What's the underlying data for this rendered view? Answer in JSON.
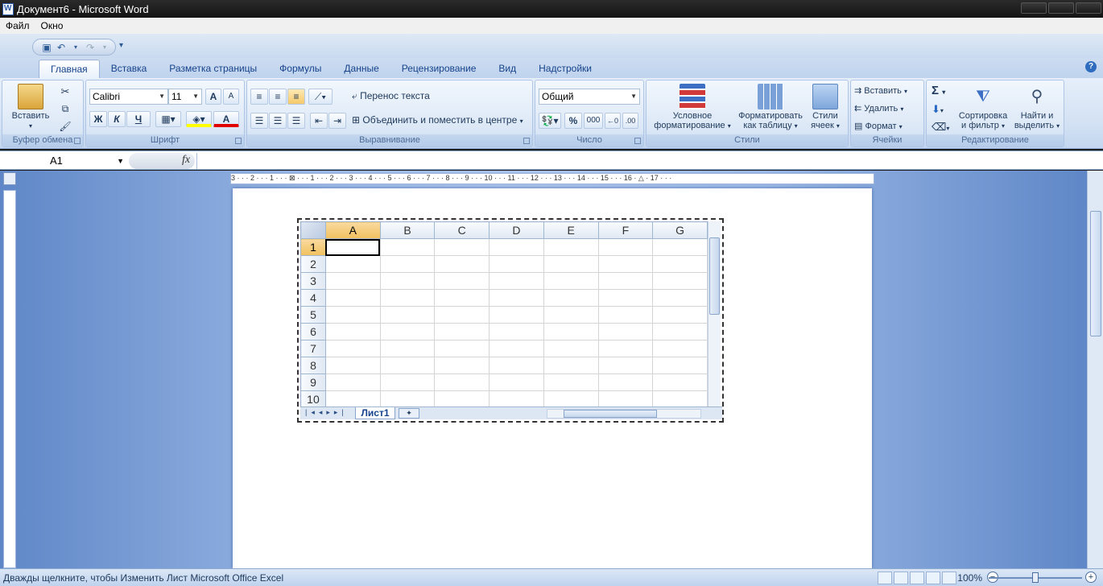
{
  "window": {
    "title": "Документ6 - Microsoft Word"
  },
  "menu": [
    "Файл",
    "Окно"
  ],
  "ribbon": {
    "tabs": [
      "Главная",
      "Вставка",
      "Разметка страницы",
      "Формулы",
      "Данные",
      "Рецензирование",
      "Вид",
      "Надстройки"
    ],
    "clipboard": {
      "paste": "Вставить",
      "label": "Буфер обмена"
    },
    "font": {
      "name": "Calibri",
      "size": "11",
      "label": "Шрифт",
      "bold": "Ж",
      "italic": "К",
      "underline": "Ч",
      "grow": "A",
      "shrink": "A",
      "font_color": "A"
    },
    "alignment": {
      "wrap": "Перенос текста",
      "merge": "Объединить и поместить в центре",
      "label": "Выравнивание"
    },
    "number": {
      "format": "Общий",
      "percent": "%",
      "thousands": "000",
      "label": "Число"
    },
    "styles": {
      "conditional_1": "Условное",
      "conditional_2": "форматирование",
      "table_1": "Форматировать",
      "table_2": "как таблицу",
      "cell_1": "Стили",
      "cell_2": "ячеек",
      "label": "Стили"
    },
    "cells": {
      "insert": "Вставить",
      "delete": "Удалить",
      "format": "Формат",
      "label": "Ячейки"
    },
    "editing": {
      "sum": "Σ",
      "sort_1": "Сортировка",
      "sort_2": "и фильтр",
      "find_1": "Найти и",
      "find_2": "выделить",
      "label": "Редактирование"
    }
  },
  "formula_bar": {
    "name_box": "A1",
    "fx": "fx",
    "value": ""
  },
  "sheet": {
    "columns": [
      "A",
      "B",
      "C",
      "D",
      "E",
      "F",
      "G"
    ],
    "rows": [
      "1",
      "2",
      "3",
      "4",
      "5",
      "6",
      "7",
      "8",
      "9",
      "10"
    ],
    "active_cell": "A1",
    "tab": "Лист1"
  },
  "ruler": {
    "labels": "3 · · · 2 · · · 1 · · · ⊠ · · · 1 · · · 2 · · · 3 · · · 4 · · · 5 · · · 6 · · · 7 · · · 8 · · · 9 · · · 10 · · · 11 · · · 12 · · · 13 · · · 14 · · · 15 · · · 16 · △ · 17 · · ·"
  },
  "status": {
    "message": "Дважды щелкните, чтобы Изменить Лист Microsoft Office Excel",
    "zoom": "100%"
  },
  "colors": {
    "accent": "#15428b",
    "selection": "#f1c15f",
    "ribbon": "#d1e0f3"
  }
}
